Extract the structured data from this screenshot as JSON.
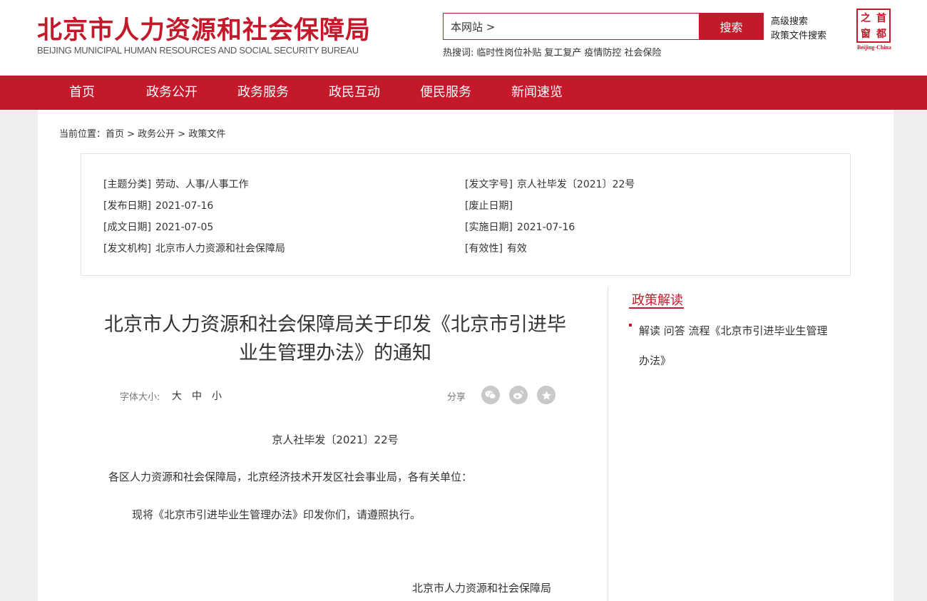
{
  "header": {
    "title": "北京市人力资源和社会保障局",
    "subtitle": "BEIJING MUNICIPAL HUMAN RESOURCES AND SOCIAL SECURITY BUREAU",
    "search": {
      "scope_text": "本网站 >",
      "button_label": "搜索"
    },
    "advanced_search": "高级搜索",
    "policy_search": "政策文件搜索",
    "hot_search": {
      "label": "热搜词:",
      "terms": [
        "临时性岗位补贴",
        "复工复产",
        "疫情防控",
        "社会保险"
      ]
    },
    "capital_logo": {
      "chars": [
        "之",
        "首",
        "窗",
        "都"
      ],
      "caption": "Beijing-China"
    }
  },
  "nav": {
    "items": [
      "首页",
      "政务公开",
      "政务服务",
      "政民互动",
      "便民服务",
      "新闻速览"
    ]
  },
  "breadcrumb": "当前位置：首页 > 政务公开 > 政策文件",
  "meta": {
    "topic": {
      "label": "[主题分类]",
      "value": "劳动、人事/人事工作"
    },
    "doc_no": {
      "label": "[发文字号]",
      "value": "京人社毕发〔2021〕22号"
    },
    "publish_date": {
      "label": "[发布日期]",
      "value": "2021-07-16"
    },
    "repeal_date": {
      "label": "[废止日期]",
      "value": ""
    },
    "written_date": {
      "label": "[成文日期]",
      "value": "2021-07-05"
    },
    "effective_date": {
      "label": "[实施日期]",
      "value": "2021-07-16"
    },
    "issuer": {
      "label": "[发文机构]",
      "value": "北京市人力资源和社会保障局"
    },
    "validity": {
      "label": "[有效性]",
      "value": "有效"
    }
  },
  "article": {
    "title": "北京市人力资源和社会保障局关于印发《北京市引进毕业生管理办法》的通知",
    "font_size_label": "字体大小:",
    "font_sizes": [
      "大",
      "中",
      "小"
    ],
    "share_label": "分享",
    "doc_number": "京人社毕发〔2021〕22号",
    "addressee": "各区人力资源和社会保障局，北京经济技术开发区社会事业局，各有关单位：",
    "body": "现将《北京市引进毕业生管理办法》印发你们，请遵照执行。",
    "signature": "北京市人力资源和社会保障局"
  },
  "sidebar": {
    "title": "政策解读",
    "link": "解读 问答 流程《北京市引进毕业生管理办法》"
  },
  "colors": {
    "brand_red": "#c3192b",
    "share_icon_gray": "#c9c9c9"
  }
}
